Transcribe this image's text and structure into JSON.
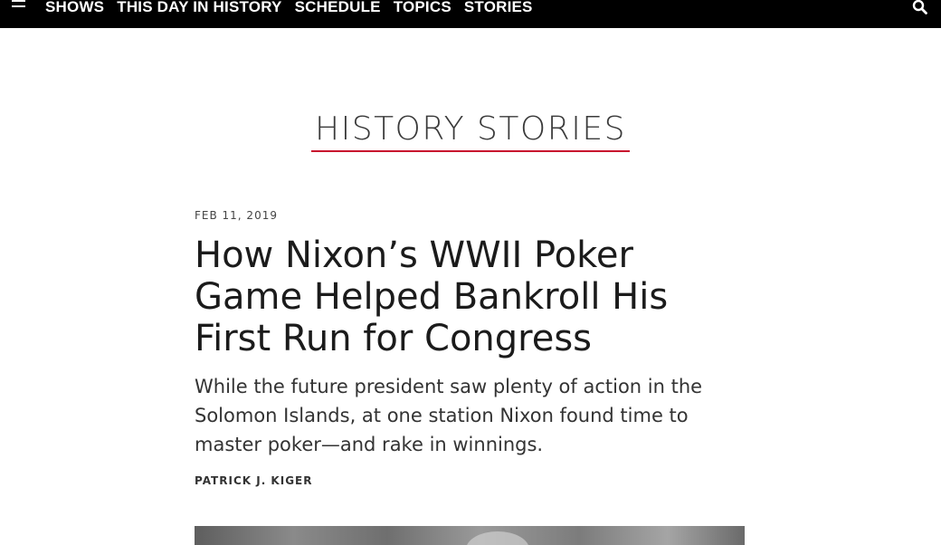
{
  "topbar": {
    "menu_icon": "hamburger-menu-icon",
    "nav_items": [
      "SHOWS",
      "THIS DAY IN HISTORY",
      "SCHEDULE",
      "TOPICS",
      "STORIES"
    ],
    "search_icon": "search-icon"
  },
  "section": {
    "title": "HISTORY STORIES",
    "accent_color": "#c8102e"
  },
  "article": {
    "date": "FEB 11, 2019",
    "headline": "How Nixon’s WWII Poker Game Helped Bankroll His First Run for Congress",
    "dek": "While the future president saw plenty of action in the Solomon Islands, at one station Nixon found time to master poker—and rake in winnings.",
    "byline": "PATRICK J. KIGER"
  }
}
